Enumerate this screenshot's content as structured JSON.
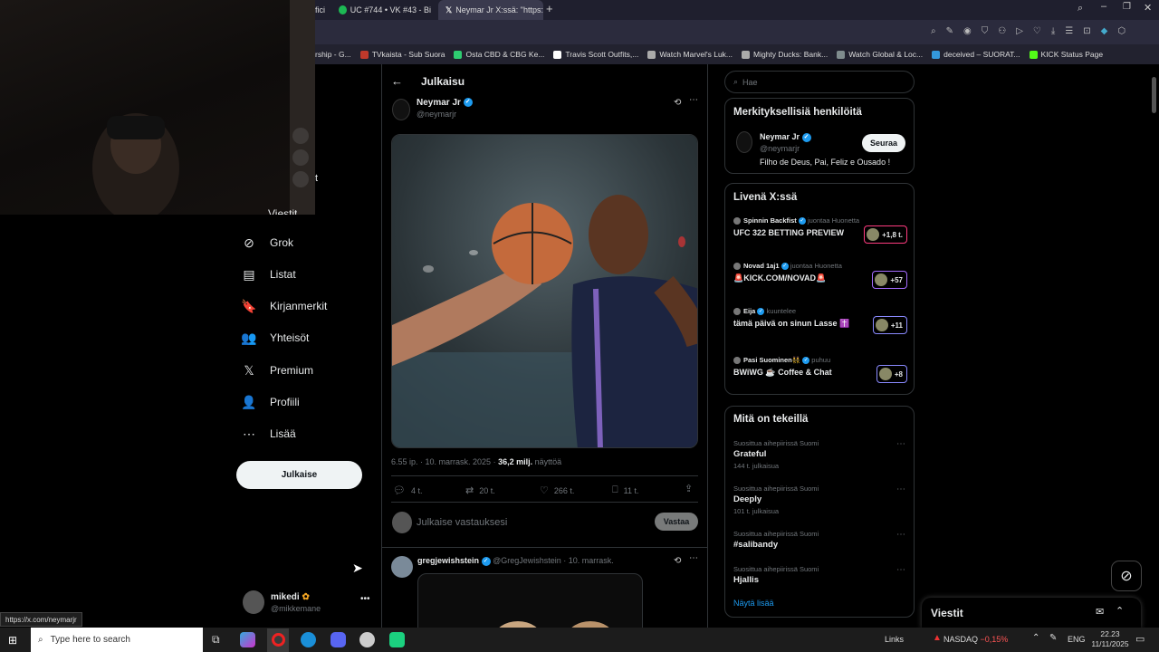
{
  "browser": {
    "tabs": [
      {
        "label": "fici"
      },
      {
        "label": "UC #744 • VK #43 - Bi"
      },
      {
        "label": "Neymar Jr X:ssä: \"https://"
      }
    ],
    "bookmarks": [
      {
        "label": "rship - G...",
        "color": "#888"
      },
      {
        "label": "TVkaista - Sub Suora",
        "color": "#c0392b"
      },
      {
        "label": "Osta CBD & CBG Ke...",
        "color": "#2ecc71"
      },
      {
        "label": "Travis Scott Outfits,...",
        "color": "#ffffff"
      },
      {
        "label": "Watch Marvel's Luk...",
        "color": "#aaa"
      },
      {
        "label": "Mighty Ducks: Bank...",
        "color": "#aaa"
      },
      {
        "label": "Watch Global & Loc...",
        "color": "#7f8c8d"
      },
      {
        "label": "deceived – SUORAT...",
        "color": "#3498db"
      },
      {
        "label": "KICK Status Page",
        "color": "#53fc18"
      }
    ],
    "status_url": "https://x.com/neymarjr"
  },
  "nav": {
    "partial_top": "Viestit",
    "partial_right": "t",
    "items": [
      {
        "label": "Grok",
        "icon": "grok-icon",
        "glyph": "⊘"
      },
      {
        "label": "Listat",
        "icon": "list-icon",
        "glyph": "▤"
      },
      {
        "label": "Kirjanmerkit",
        "icon": "bookmark-icon",
        "glyph": "🔖"
      },
      {
        "label": "Yhteisöt",
        "icon": "communities-icon",
        "glyph": "👥"
      },
      {
        "label": "Premium",
        "icon": "x-logo-icon",
        "glyph": "𝕏"
      },
      {
        "label": "Profiili",
        "icon": "profile-icon",
        "glyph": "👤"
      },
      {
        "label": "Lisää",
        "icon": "more-circle-icon",
        "glyph": "⋯"
      }
    ],
    "post_button": "Julkaise",
    "account": {
      "name": "mikedi",
      "handle": "@mikkemane"
    }
  },
  "post": {
    "header_title": "Julkaisu",
    "author_name": "Neymar Jr",
    "author_handle": "@neymarjr",
    "meta_time": "6.55 ip. · 10. marrask. 2025",
    "meta_views_count": "36,2 milj.",
    "meta_views_label": "näyttöä",
    "stats": {
      "replies": "4 t.",
      "reposts": "20 t.",
      "likes": "266 t.",
      "bookmarks": "11 t."
    },
    "reply_placeholder": "Julkaise vastauksesi",
    "reply_button": "Vastaa"
  },
  "reply": {
    "name": "gregjewishstein",
    "handle": "@GregJewishstein",
    "date": "10. marrask."
  },
  "right": {
    "search_placeholder": "Hae",
    "people": {
      "title": "Merkityksellisiä henkilöitä",
      "name": "Neymar Jr",
      "handle": "@neymarjr",
      "bio": "Filho de Deus, Pai, Feliz e Ousado !",
      "follow": "Seuraa"
    },
    "live": {
      "title": "Livenä X:ssä",
      "items": [
        {
          "host": "Spinnin Backfist",
          "action": "juontaa Huonetta",
          "title": "UFC 322 BETTING PREVIEW",
          "count": "+1,8 t."
        },
        {
          "host": "Novad 1aj1",
          "action": "juontaa Huonetta",
          "title": "🚨KICK.COM/NOVAD🚨",
          "count": "+57"
        },
        {
          "host": "Eija",
          "action": "kuuntelee",
          "title": "tämä päivä on sinun Lasse ✝️",
          "count": "+11"
        },
        {
          "host": "Pasi Suominen👯",
          "action": "puhuu",
          "title": "BWiWG ☕ Coffee & Chat",
          "count": "+8"
        }
      ]
    },
    "trends": {
      "title": "Mitä on tekeillä",
      "items": [
        {
          "context": "Suosittua aihepiirissä Suomi",
          "name": "Grateful",
          "count": "144 t. julkaisua"
        },
        {
          "context": "Suosittua aihepiirissä Suomi",
          "name": "Deeply",
          "count": "101 t. julkaisua"
        },
        {
          "context": "Suosittua aihepiirissä Suomi",
          "name": "#salibandy",
          "count": ""
        },
        {
          "context": "Suosittua aihepiirissä Suomi",
          "name": "Hjallis",
          "count": ""
        }
      ],
      "show_more": "Näytä lisää"
    },
    "messages_label": "Viestit"
  },
  "taskbar": {
    "search_placeholder": "Type here to search",
    "links": "Links",
    "ticker": "NASDAQ",
    "ticker_change": "−0,15%",
    "lang": "ENG",
    "time": "22.23",
    "date": "11/11/2025"
  }
}
